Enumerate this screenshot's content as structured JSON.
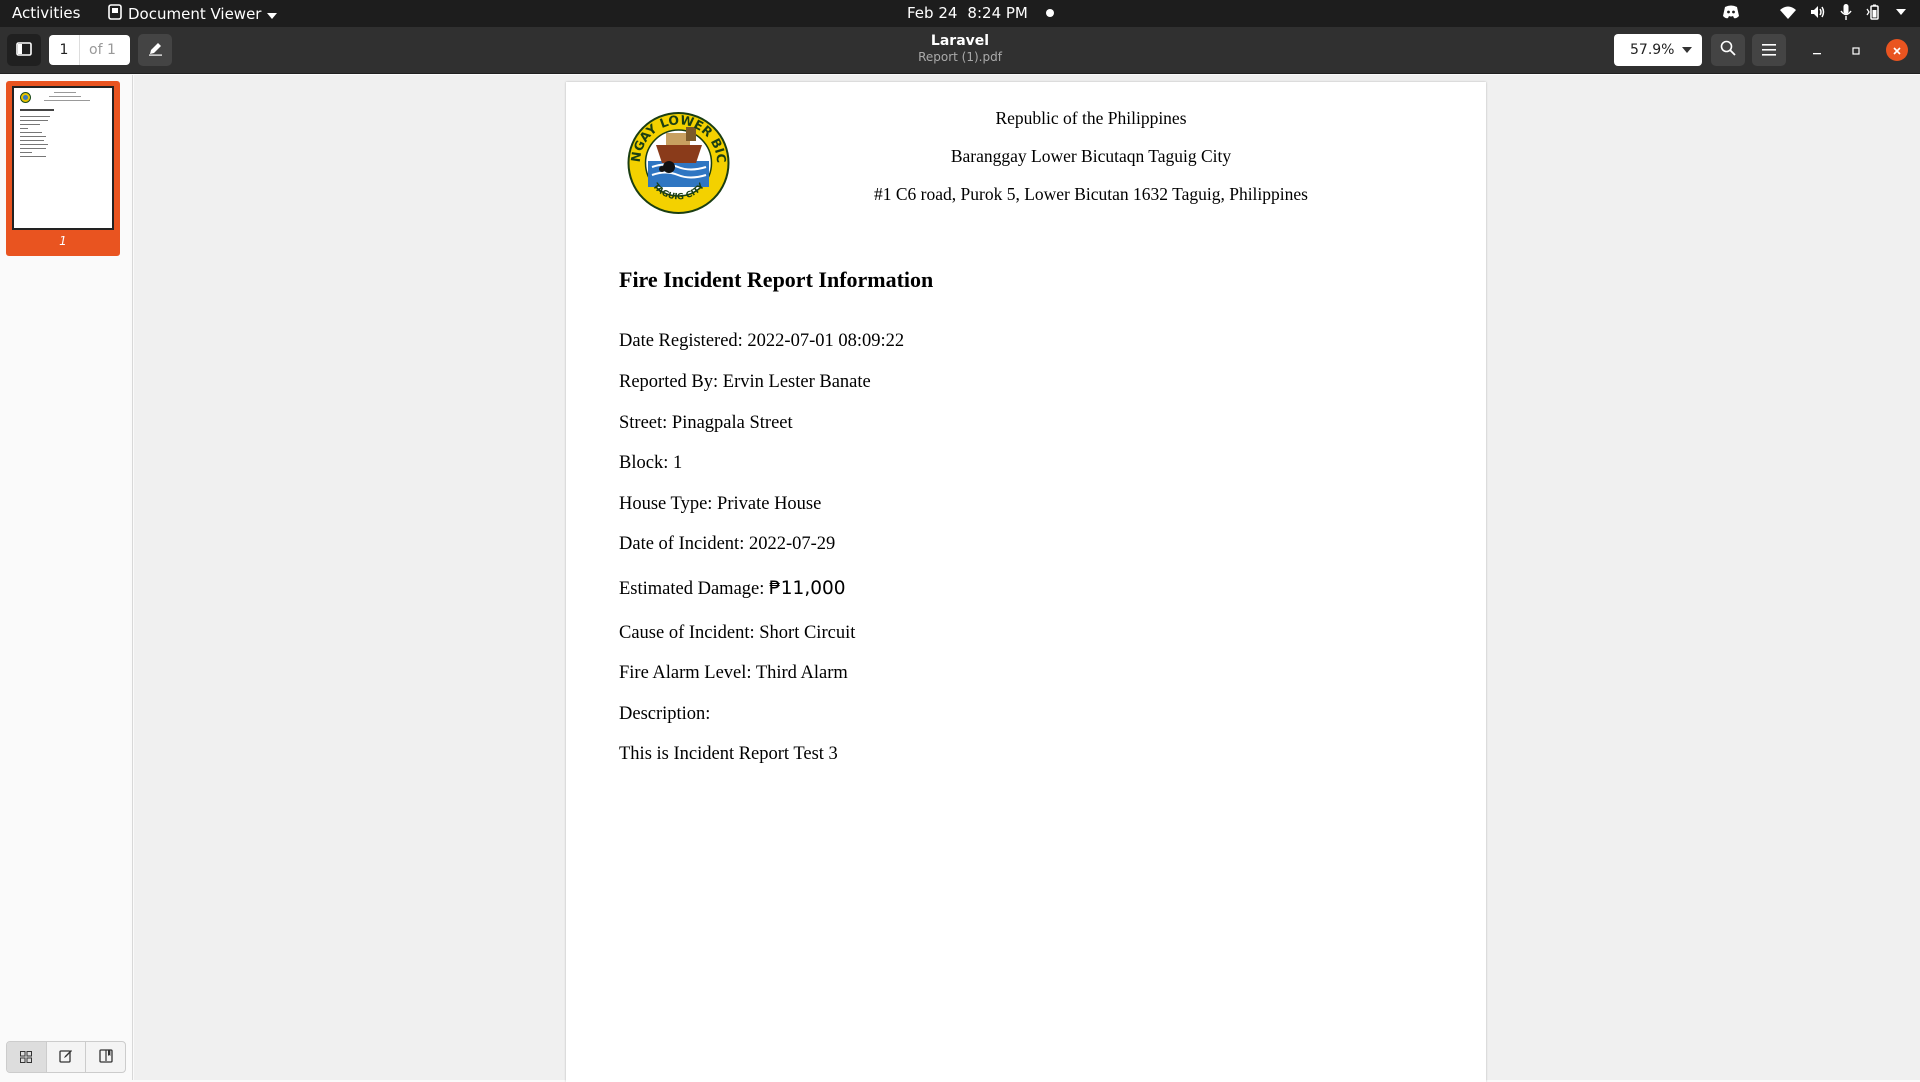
{
  "topbar": {
    "activities": "Activities",
    "app_name": "Document Viewer",
    "date": "Feb 24",
    "time": "8:24 PM"
  },
  "headerbar": {
    "current_page": "1",
    "total_pages": "of 1",
    "title": "Laravel",
    "subtitle": "Report (1).pdf",
    "zoom": "57.9%"
  },
  "sidebar": {
    "thumbnail_label": "1"
  },
  "document": {
    "header": [
      "Republic of the Philippines",
      "Baranggay Lower Bicutaqn Taguig City",
      "#1 C6 road, Purok 5, Lower Bicutan 1632 Taguig, Philippines"
    ],
    "seal_text_top": "BARANGAY LOWER BICUTAN",
    "seal_text_bottom": "TAGUIG CITY",
    "title": "Fire Incident Report Information",
    "fields": {
      "date_registered": "Date Registered: 2022-07-01 08:09:22",
      "reported_by": "Reported By: Ervin Lester Banate",
      "street": "Street: Pinagpala Street",
      "block": "Block: 1",
      "house_type": "House Type: Private House",
      "date_of_incident": "Date of Incident: 2022-07-29",
      "estimated_damage_label": "Estimated Damage: ",
      "estimated_damage_value": "₱11,000",
      "cause": "Cause of Incident: Short Circuit",
      "alarm_level": "Fire Alarm Level: Third Alarm",
      "description_label": "Description:",
      "description": "This is Incident Report Test 3"
    }
  },
  "colors": {
    "accent": "#e95420",
    "topbar": "#1d1d1d",
    "headerbar": "#303030"
  },
  "icons": {
    "sidebar_toggle": "sidebar-toggle-icon",
    "annotate": "pencil-icon",
    "search": "search-icon",
    "menu": "hamburger-menu-icon",
    "minimize": "minimize-icon",
    "maximize": "maximize-icon",
    "close": "close-icon"
  }
}
